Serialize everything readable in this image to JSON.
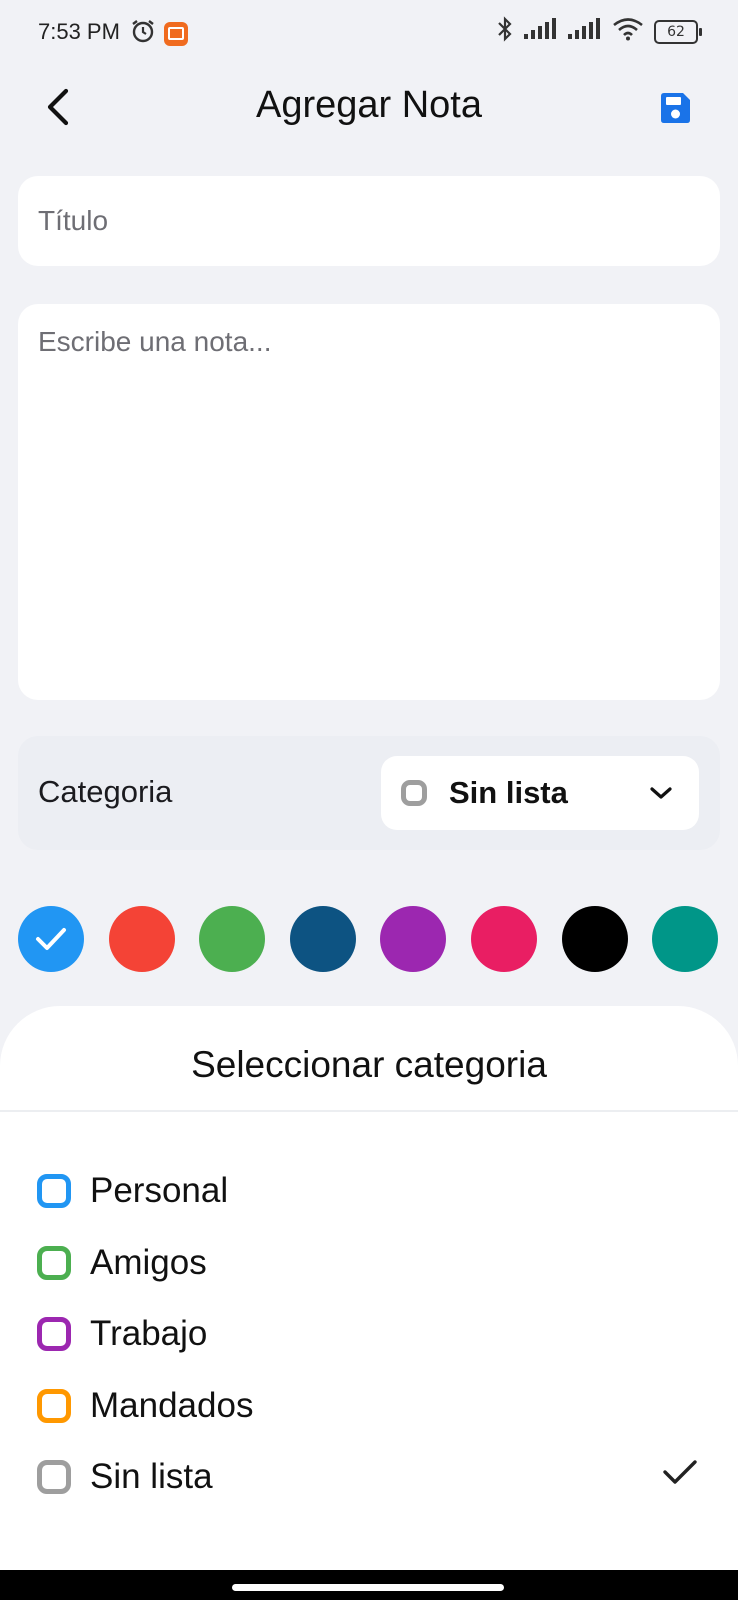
{
  "status_bar": {
    "time": "7:53 PM",
    "icons": [
      "alarm-icon",
      "mi-app-icon",
      "bluetooth-icon",
      "signal-icon",
      "signal-icon",
      "wifi-icon"
    ],
    "battery": "62"
  },
  "header": {
    "title": "Agregar Nota",
    "back_icon": "chevron-left-icon",
    "save_icon": "floppy-disk-icon",
    "accent": "#1a73e8"
  },
  "form": {
    "title_placeholder": "Título",
    "title_value": "",
    "note_placeholder": "Escribe una nota...",
    "note_value": ""
  },
  "category": {
    "label": "Categoria",
    "selected": "Sin lista",
    "selected_color": "#9e9e9e"
  },
  "colors": {
    "swatches": [
      "#2196f3",
      "#f44336",
      "#4caf50",
      "#0d5382",
      "#9c27b0",
      "#e91e63",
      "#000000",
      "#009688"
    ],
    "selected_index": 0
  },
  "sheet": {
    "title": "Seleccionar categoria",
    "options": [
      {
        "label": "Personal",
        "color": "#2196f3",
        "selected": false
      },
      {
        "label": "Amigos",
        "color": "#4caf50",
        "selected": false
      },
      {
        "label": "Trabajo",
        "color": "#9c27b0",
        "selected": false
      },
      {
        "label": "Mandados",
        "color": "#ff9800",
        "selected": false
      },
      {
        "label": "Sin lista",
        "color": "#9e9e9e",
        "selected": true
      }
    ]
  }
}
